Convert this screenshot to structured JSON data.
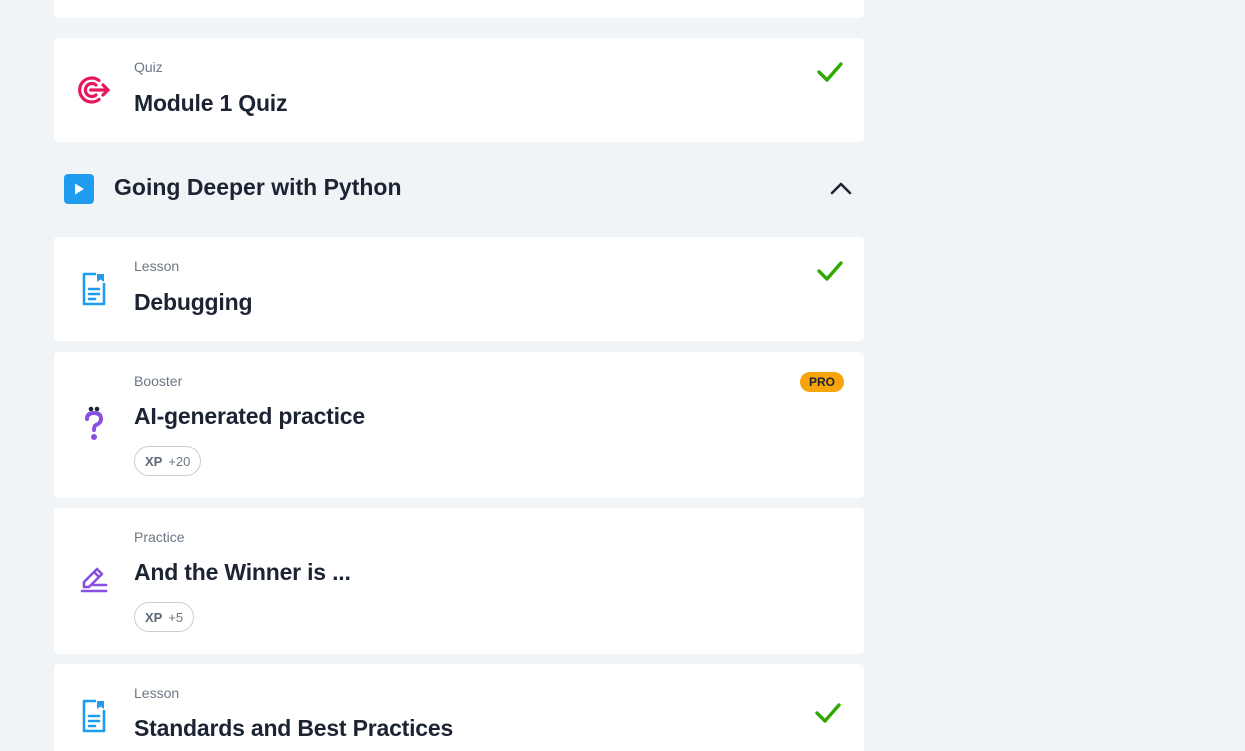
{
  "items": [
    {
      "type": "Quiz",
      "title": "Module 1 Quiz",
      "icon": "target-icon",
      "status": "completed"
    },
    {
      "type": "Lesson",
      "title": "Debugging",
      "icon": "lesson-doc-icon",
      "status": "completed"
    },
    {
      "type": "Booster",
      "title": "AI-generated practice",
      "icon": "question-mark-icon",
      "xp_label": "XP",
      "xp_value": "+20",
      "badge": "PRO"
    },
    {
      "type": "Practice",
      "title": "And the Winner is ...",
      "icon": "pencil-icon",
      "xp_label": "XP",
      "xp_value": "+5"
    },
    {
      "type": "Lesson",
      "title": "Standards and Best Practices",
      "icon": "lesson-doc-icon",
      "status": "completed"
    }
  ],
  "section": {
    "title": "Going Deeper with Python",
    "icon": "play-icon",
    "expanded": true
  },
  "colors": {
    "background": "#f0f4f7",
    "check": "#2fa800",
    "target": "#e8175d",
    "lesson": "#1f9cf0",
    "booster": "#8a4fe0",
    "pro": "#f7a30a"
  }
}
